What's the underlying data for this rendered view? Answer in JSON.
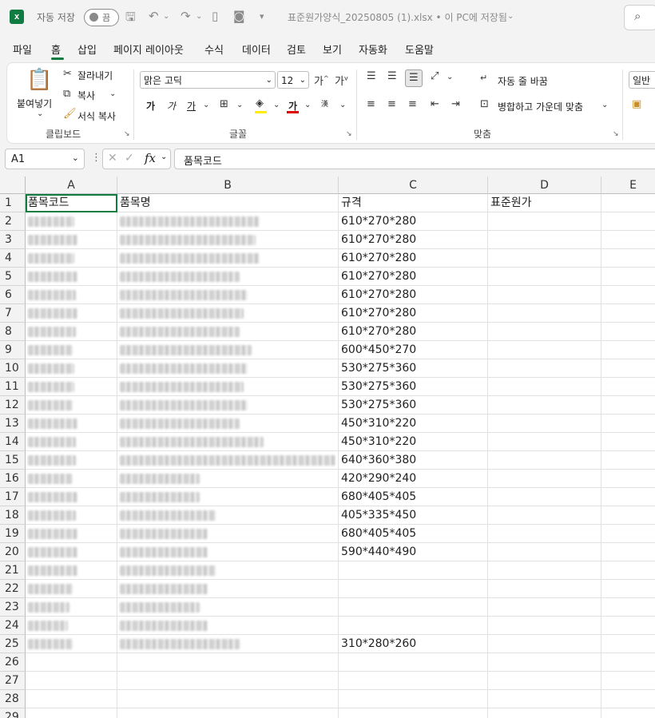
{
  "titlebar": {
    "autosave_label": "자동 저장",
    "autosave_state": "끔",
    "doc_title": "표준원가양식_20250805 (1).xlsx • 이 PC에 저장됨"
  },
  "menu": [
    "파일",
    "홈",
    "삽입",
    "페이지 레이아웃",
    "수식",
    "데이터",
    "검토",
    "보기",
    "자동화",
    "도움말"
  ],
  "ribbon": {
    "clipboard": {
      "paste": "붙여넣기",
      "cut": "잘라내기",
      "copy": "복사",
      "format_painter": "서식 복사",
      "group": "클립보드"
    },
    "font": {
      "font_name": "맑은 고딕",
      "font_size": "12",
      "bold": "가",
      "italic": "가",
      "underline": "가",
      "font_color": "가",
      "group": "글꼴"
    },
    "alignment": {
      "wrap_text": "자동 줄 바꿈",
      "merge_center": "병합하고 가운데 맞춤",
      "group": "맞춤"
    },
    "number": {
      "format": "일반"
    }
  },
  "formula_bar": {
    "name_box": "A1",
    "fx": "fx",
    "value": "품목코드"
  },
  "grid": {
    "columns": [
      "A",
      "B",
      "C",
      "D",
      "E"
    ],
    "headers": {
      "A": "품목코드",
      "B": "품목명",
      "C": "규격",
      "D": "표준원가"
    },
    "rows": [
      {
        "row": "1"
      },
      {
        "row": "2",
        "C": "610*270*280"
      },
      {
        "row": "3",
        "C": "610*270*280"
      },
      {
        "row": "4",
        "C": "610*270*280"
      },
      {
        "row": "5",
        "C": "610*270*280"
      },
      {
        "row": "6",
        "C": "610*270*280"
      },
      {
        "row": "7",
        "C": "610*270*280"
      },
      {
        "row": "8",
        "C": "610*270*280"
      },
      {
        "row": "9",
        "C": "600*450*270"
      },
      {
        "row": "10",
        "C": "530*275*360"
      },
      {
        "row": "11",
        "C": "530*275*360"
      },
      {
        "row": "12",
        "C": "530*275*360"
      },
      {
        "row": "13",
        "C": "450*310*220"
      },
      {
        "row": "14",
        "C": "450*310*220"
      },
      {
        "row": "15",
        "C": "640*360*380"
      },
      {
        "row": "16",
        "C": "420*290*240"
      },
      {
        "row": "17",
        "C": "680*405*405"
      },
      {
        "row": "18",
        "C": "405*335*450"
      },
      {
        "row": "19",
        "C": "680*405*405"
      },
      {
        "row": "20",
        "C": "590*440*490"
      },
      {
        "row": "21",
        "C": ""
      },
      {
        "row": "22",
        "C": ""
      },
      {
        "row": "23",
        "C": ""
      },
      {
        "row": "24",
        "C": ""
      },
      {
        "row": "25",
        "C": "310*280*260"
      },
      {
        "row": "26"
      },
      {
        "row": "27"
      },
      {
        "row": "28"
      },
      {
        "row": "29"
      }
    ]
  }
}
